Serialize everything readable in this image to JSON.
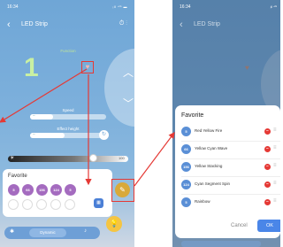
{
  "left_screen": {
    "status_time": "16:34",
    "status_indicators": "ᵢll ⁴ᴳ ▬",
    "title": "LED Strip",
    "function_label": "Function",
    "function_number": "1",
    "speed_label": "Speed",
    "speed_level": 0.3,
    "effect_height_label": "Effect height",
    "effect_height_level": 0.45,
    "brightness_value": "100",
    "brightness_level": 0.72,
    "favorite_title": "Favorite",
    "favorite_chips": [
      "5",
      "66",
      "156",
      "124",
      "5"
    ],
    "nav_label": "Dynamic"
  },
  "right_screen": {
    "status_time": "16:34",
    "status_indicators": "ᵢll ⁴ᴳ",
    "title": "LED Strip",
    "modal": {
      "title": "Favorite",
      "items": [
        {
          "num": "5",
          "name": "Red Yellow Fire"
        },
        {
          "num": "66",
          "name": "Yellow Cyan Wave"
        },
        {
          "num": "156",
          "name": "Yellow Stacking"
        },
        {
          "num": "124",
          "name": "Cyan Segment Spin"
        },
        {
          "num": "5",
          "name": "Rainbow"
        }
      ],
      "cancel_label": "Cancel",
      "ok_label": "OK"
    }
  },
  "colors": {
    "accent_red": "#e53935",
    "ok_blue": "#4a86e8",
    "chip_purple": "#a46bbf",
    "edit_gold": "#d9a93a"
  }
}
